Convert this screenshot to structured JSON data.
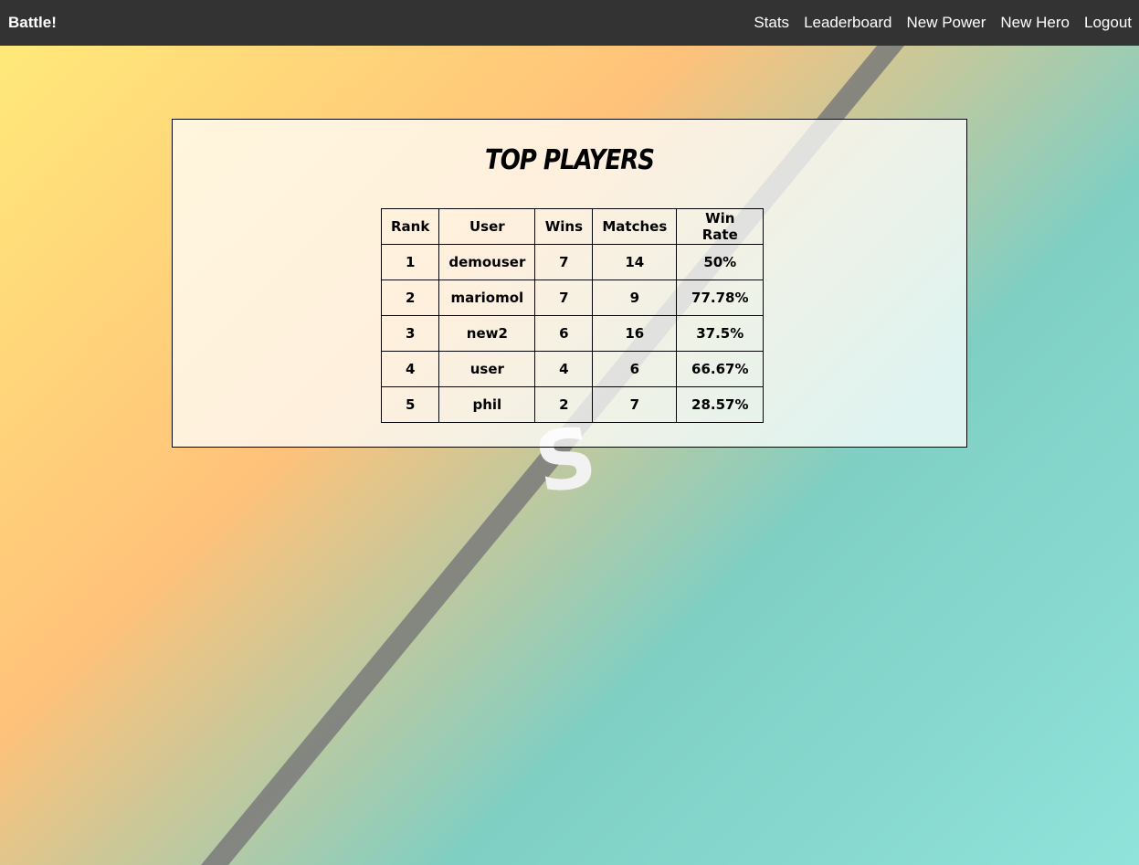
{
  "navbar": {
    "brand": "Battle!",
    "links": [
      "Stats",
      "Leaderboard",
      "New Power",
      "New Hero",
      "Logout"
    ]
  },
  "leaderboard": {
    "title": "TOP PLAYERS",
    "columns": [
      "Rank",
      "User",
      "Wins",
      "Matches",
      "Win Rate"
    ],
    "rows": [
      [
        "1",
        "demouser",
        "7",
        "14",
        "50%"
      ],
      [
        "2",
        "mariomol",
        "7",
        "9",
        "77.78%"
      ],
      [
        "3",
        "new2",
        "6",
        "16",
        "37.5%"
      ],
      [
        "4",
        "user",
        "4",
        "6",
        "66.67%"
      ],
      [
        "5",
        "phil",
        "2",
        "7",
        "28.57%"
      ]
    ]
  },
  "colors": {
    "navbar": "#333333",
    "background_left": "#ffc27a",
    "background_right": "#8fe3da"
  }
}
